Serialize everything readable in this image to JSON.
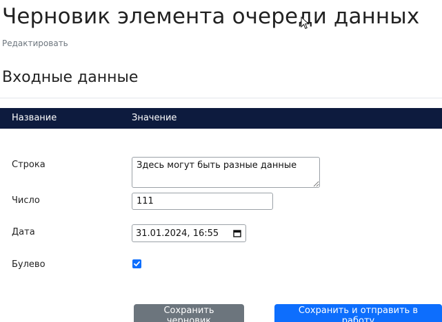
{
  "page": {
    "title": "Черновик элемента очереди данных",
    "edit_link": "Редактировать",
    "section_title": "Входные данные"
  },
  "table": {
    "col_name": "Название",
    "col_value": "Значение"
  },
  "fields": {
    "string": {
      "label": "Строка",
      "value": "Здесь могут быть разные данные"
    },
    "number": {
      "label": "Число",
      "value": "111"
    },
    "date": {
      "label": "Дата",
      "value": "31.01.2024, 16:55"
    },
    "boolean": {
      "label": "Булево",
      "checked": true
    }
  },
  "buttons": {
    "save_draft": "Сохранить черновик",
    "save_send": "Сохранить и отправить в работу"
  },
  "colors": {
    "header_bg": "#0d1b3e",
    "primary": "#0d6efd",
    "secondary": "#6c757d"
  }
}
